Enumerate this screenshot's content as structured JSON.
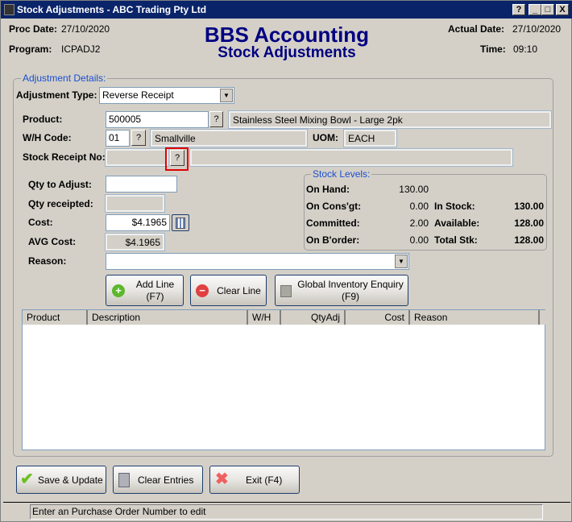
{
  "window": {
    "title": "Stock Adjustments - ABC Trading Pty Ltd",
    "help": "?",
    "minimize": "_",
    "maximize": "□",
    "close": "X"
  },
  "header": {
    "proc_date_label": "Proc Date:",
    "proc_date": "27/10/2020",
    "program_label": "Program:",
    "program": "ICPADJ2",
    "app_title": "BBS Accounting",
    "screen_title": "Stock Adjustments",
    "actual_date_label": "Actual Date:",
    "actual_date": "27/10/2020",
    "time_label": "Time:",
    "time": "09:10"
  },
  "details": {
    "legend": "Adjustment Details:",
    "adjustment_type_label": "Adjustment Type:",
    "adjustment_type": "Reverse Receipt",
    "product_label": "Product:",
    "product": "500005",
    "product_desc": "Stainless Steel Mixing Bowl - Large 2pk",
    "wh_label": "W/H Code:",
    "wh_code": "01",
    "wh_name": "Smallville",
    "uom_label": "UOM:",
    "uom": "EACH",
    "receipt_label": "Stock Receipt No:",
    "receipt_no": "",
    "lookup": "?",
    "qty_adjust_label": "Qty to Adjust:",
    "qty_adjust": "",
    "qty_receipted_label": "Qty receipted:",
    "qty_receipted": "",
    "cost_label": "Cost:",
    "cost": "$4.1965",
    "avg_cost_label": "AVG Cost:",
    "avg_cost": "$4.1965",
    "reason_label": "Reason:",
    "reason": ""
  },
  "stock_levels": {
    "legend": "Stock Levels:",
    "on_hand_label": "On Hand:",
    "on_hand": "130.00",
    "on_consgt_label": "On Cons'gt:",
    "on_consgt": "0.00",
    "committed_label": "Committed:",
    "committed": "2.00",
    "on_border_label": "On B'order:",
    "on_border": "0.00",
    "in_stock_label": "In Stock:",
    "in_stock": "130.00",
    "available_label": "Available:",
    "available": "128.00",
    "total_label": "Total Stk:",
    "total": "128.00"
  },
  "actions": {
    "add_line": "Add Line",
    "add_line_key": "(F7)",
    "clear_line": "Clear Line",
    "global": "Global Inventory Enquiry",
    "global_key": "(F9)"
  },
  "table": {
    "columns": [
      "Product",
      "Description",
      "W/H",
      "QtyAdj",
      "Cost",
      "Reason"
    ]
  },
  "footer": {
    "save": "Save & Update",
    "clear": "Clear Entries",
    "exit": "Exit (F4)"
  },
  "status": "Enter an Purchase Order Number to edit"
}
